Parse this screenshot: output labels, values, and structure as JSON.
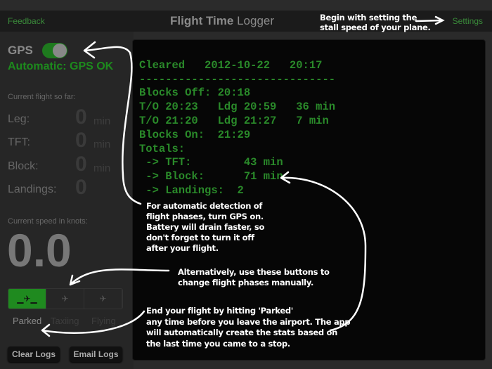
{
  "header": {
    "feedback": "Feedback",
    "title_bold": "Flight Time",
    "title_light": " Logger",
    "settings": "Settings"
  },
  "gps": {
    "label": "GPS",
    "toggle_on": true,
    "status": "Automatic:  GPS OK"
  },
  "current": {
    "heading": "Current flight so far:",
    "rows": [
      {
        "label": "Leg:",
        "value": "0",
        "unit": "min"
      },
      {
        "label": "TFT:",
        "value": "0",
        "unit": "min"
      },
      {
        "label": "Block:",
        "value": "0",
        "unit": "min"
      },
      {
        "label": "Landings:",
        "value": "0"
      }
    ]
  },
  "speed": {
    "label": "Current speed in knots:",
    "value": "0.0"
  },
  "phases": [
    {
      "label": "Parked",
      "icon": "parked-plane-icon",
      "active": true
    },
    {
      "label": "Taxiing",
      "icon": "taxiing-plane-icon"
    },
    {
      "label": "Flying",
      "icon": "flying-plane-icon"
    }
  ],
  "buttons": {
    "clear": "Clear Logs",
    "email": "Email Logs"
  },
  "log": [
    "Cleared   2012-10-22   20:17",
    "------------------------------",
    "Blocks Off: 20:18",
    "T/O 20:23   Ldg 20:59   36 min",
    "T/O 21:20   Ldg 21:27   7 min",
    "Blocks On:  21:29",
    "Totals:",
    " -> TFT:        43 min",
    " -> Block:      71 min",
    " -> Landings:  2"
  ],
  "annotations": {
    "settings": [
      "Begin with setting the",
      "stall speed of your plane."
    ],
    "gps": [
      "For automatic detection of",
      "flight phases, turn GPS on.",
      "Battery will drain faster, so",
      "don't forget to turn it off",
      "after your flight."
    ],
    "phases": [
      "Alternatively, use these buttons to",
      "change flight phases manually."
    ],
    "parked": [
      "End your flight by hitting 'Parked'",
      "any time before you leave the airport.  The app",
      "will automatically create the stats based on",
      "the last time you came to a stop."
    ]
  }
}
